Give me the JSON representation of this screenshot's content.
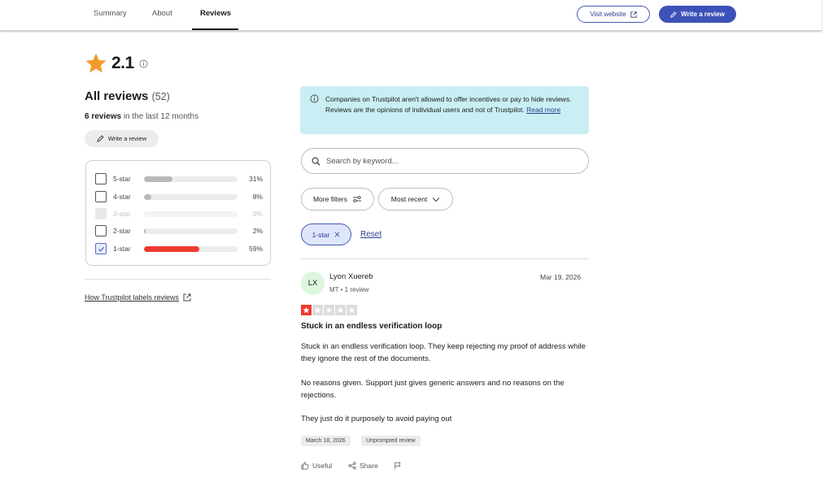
{
  "nav": {
    "tabs": [
      {
        "label": "Summary",
        "active": false
      },
      {
        "label": "About",
        "active": false
      },
      {
        "label": "Reviews",
        "active": true
      }
    ],
    "visit_website": "Visit website",
    "write_review": "Write a review"
  },
  "summary": {
    "rating": "2.1",
    "title": "All reviews",
    "count": "(52)",
    "recent_count": "6 reviews",
    "recent_suffix": "in the last 12 months",
    "write_review": "Write a review",
    "distribution": [
      {
        "label": "5-star",
        "percent": 31,
        "percent_label": "31%",
        "checked": false,
        "disabled": false,
        "color": "#b8b8b8"
      },
      {
        "label": "4-star",
        "percent": 8,
        "percent_label": "8%",
        "checked": false,
        "disabled": false,
        "color": "#b8b8b8"
      },
      {
        "label": "3-star",
        "percent": 0,
        "percent_label": "0%",
        "checked": false,
        "disabled": true,
        "color": "#b8b8b8"
      },
      {
        "label": "2-star",
        "percent": 2,
        "percent_label": "2%",
        "checked": false,
        "disabled": false,
        "color": "#b8b8b8"
      },
      {
        "label": "1-star",
        "percent": 59,
        "percent_label": "59%",
        "checked": true,
        "disabled": false,
        "color": "#ee3a2e"
      }
    ],
    "labels_link": "How Trustpilot labels reviews"
  },
  "notice": {
    "text": "Companies on Trustpilot aren't allowed to offer incentives or pay to hide reviews. Reviews are the opinions of individual users and not of Trustpilot.",
    "link": "Read more"
  },
  "search": {
    "placeholder": "Search by keyword..."
  },
  "filters": {
    "more_filters": "More filters",
    "sort": "Most recent",
    "active_chip": "1-star",
    "reset": "Reset"
  },
  "review": {
    "initials": "LX",
    "author": "Lyon Xuereb",
    "meta": "MT • 1 review",
    "date": "Mar 19, 2026",
    "stars": 1,
    "star_color": "#ee3a2e",
    "title": "Stuck in an endless verification loop",
    "paragraphs": [
      "Stuck in an endless verification loop. They keep rejecting my proof of address while they ignore the rest of the documents.",
      "No reasons given. Support just gives generic answers and no reasons on the rejections.",
      "They just do it purposely to avoid paying out"
    ],
    "experience_date": "March 18, 2026",
    "tag": "Unprompted review",
    "useful": "Useful",
    "share": "Share"
  },
  "colors": {
    "brand": "#3d52b8",
    "rating_star": "#f39a2b",
    "notice_bg": "#c9eef4"
  }
}
